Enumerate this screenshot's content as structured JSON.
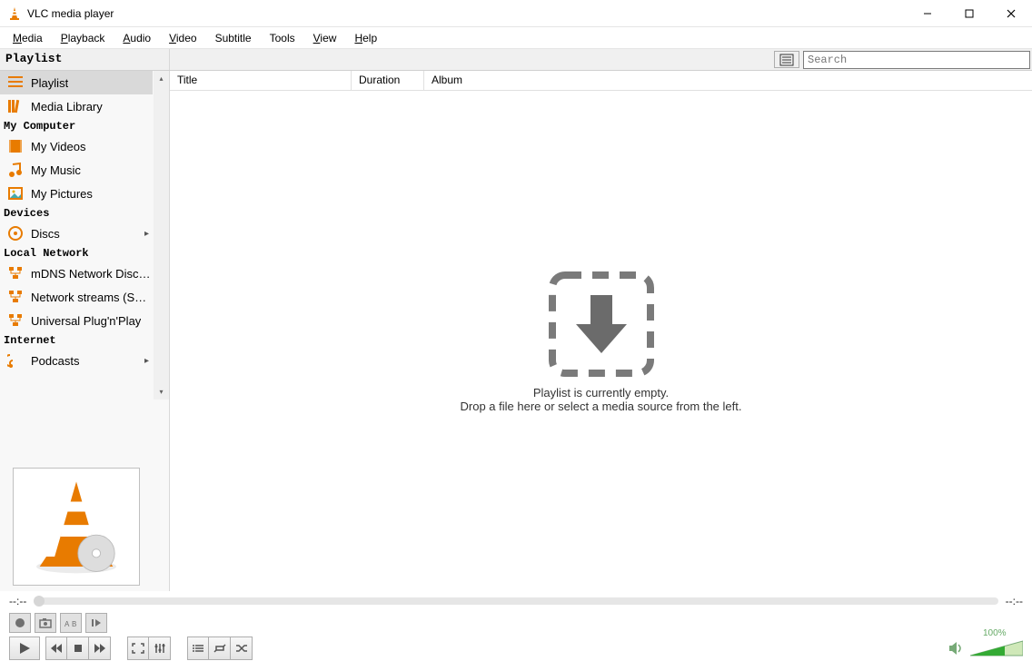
{
  "window": {
    "title": "VLC media player"
  },
  "menu": {
    "media": "Media",
    "playback": "Playback",
    "audio": "Audio",
    "video": "Video",
    "subtitle": "Subtitle",
    "tools": "Tools",
    "view": "View",
    "help": "Help"
  },
  "playlist_panel": {
    "heading": "Playlist",
    "search_placeholder": "Search"
  },
  "sidebar": {
    "playlist": "Playlist",
    "media_library": "Media Library",
    "section_my_computer": "My Computer",
    "my_videos": "My Videos",
    "my_music": "My Music",
    "my_pictures": "My Pictures",
    "section_devices": "Devices",
    "discs": "Discs",
    "section_local_network": "Local Network",
    "mdns": "mDNS Network Disco...",
    "sap": "Network streams (SAP)",
    "upnp": "Universal Plug'n'Play",
    "section_internet": "Internet",
    "podcasts": "Podcasts"
  },
  "columns": {
    "title": "Title",
    "duration": "Duration",
    "album": "Album"
  },
  "empty": {
    "line1": "Playlist is currently empty.",
    "line2": "Drop a file here or select a media source from the left."
  },
  "time": {
    "elapsed": "--:--",
    "remaining": "--:--"
  },
  "volume": {
    "label": "100%",
    "value": 100
  }
}
